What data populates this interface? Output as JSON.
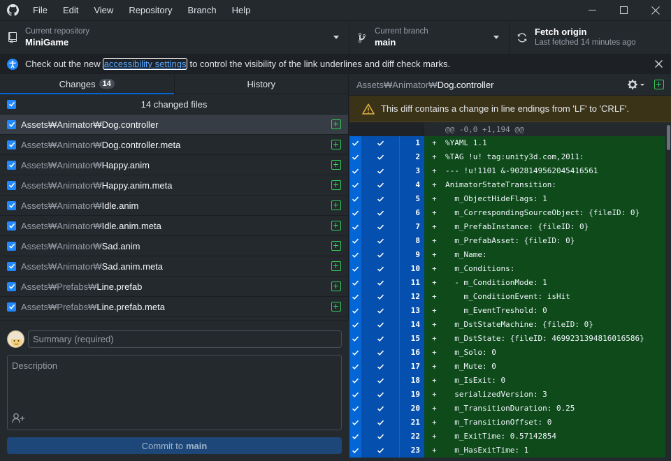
{
  "menu": [
    "File",
    "Edit",
    "View",
    "Repository",
    "Branch",
    "Help"
  ],
  "toolbar": {
    "repo_label": "Current repository",
    "repo_value": "MiniGame",
    "branch_label": "Current branch",
    "branch_value": "main",
    "fetch_label": "Fetch origin",
    "fetch_sub": "Last fetched 14 minutes ago"
  },
  "banner": {
    "before": "Check out the new",
    "link": "accessibility settings",
    "after": "to control the visibility of the link underlines and diff check marks."
  },
  "tabs": {
    "changes": "Changes",
    "changes_count": "14",
    "history": "History"
  },
  "changed_header": "14 changed files",
  "files": [
    {
      "dir": "Assets₩Animator₩",
      "name": "Dog.controller",
      "selected": true
    },
    {
      "dir": "Assets₩Animator₩",
      "name": "Dog.controller.meta"
    },
    {
      "dir": "Assets₩Animator₩",
      "name": "Happy.anim"
    },
    {
      "dir": "Assets₩Animator₩",
      "name": "Happy.anim.meta"
    },
    {
      "dir": "Assets₩Animator₩",
      "name": "Idle.anim"
    },
    {
      "dir": "Assets₩Animator₩",
      "name": "Idle.anim.meta"
    },
    {
      "dir": "Assets₩Animator₩",
      "name": "Sad.anim"
    },
    {
      "dir": "Assets₩Animator₩",
      "name": "Sad.anim.meta"
    },
    {
      "dir": "Assets₩Prefabs₩",
      "name": "Line.prefab"
    },
    {
      "dir": "Assets₩Prefabs₩",
      "name": "Line.prefab.meta"
    }
  ],
  "commit": {
    "summary_placeholder": "Summary (required)",
    "description_placeholder": "Description",
    "button_prefix": "Commit to",
    "button_branch": "main"
  },
  "diff": {
    "path_dir": "Assets₩Animator₩",
    "path_name": "Dog.controller",
    "warning": "This diff contains a change in line endings from 'LF' to 'CRLF'.",
    "hunk": "@@ -0,0 +1,194 @@",
    "lines": [
      {
        "n": "1",
        "t": "%YAML 1.1"
      },
      {
        "n": "2",
        "t": "%TAG !u! tag:unity3d.com,2011:"
      },
      {
        "n": "3",
        "t": "--- !u!1101 &-9028149562045416561"
      },
      {
        "n": "4",
        "t": "AnimatorStateTransition:"
      },
      {
        "n": "5",
        "t": "  m_ObjectHideFlags: 1"
      },
      {
        "n": "6",
        "t": "  m_CorrespondingSourceObject: {fileID: 0}"
      },
      {
        "n": "7",
        "t": "  m_PrefabInstance: {fileID: 0}"
      },
      {
        "n": "8",
        "t": "  m_PrefabAsset: {fileID: 0}"
      },
      {
        "n": "9",
        "t": "  m_Name:"
      },
      {
        "n": "10",
        "t": "  m_Conditions:"
      },
      {
        "n": "11",
        "t": "  - m_ConditionMode: 1"
      },
      {
        "n": "12",
        "t": "    m_ConditionEvent: isHit"
      },
      {
        "n": "13",
        "t": "    m_EventTreshold: 0"
      },
      {
        "n": "14",
        "t": "  m_DstStateMachine: {fileID: 0}"
      },
      {
        "n": "15",
        "t": "  m_DstState: {fileID: 4699231394816016586}"
      },
      {
        "n": "16",
        "t": "  m_Solo: 0"
      },
      {
        "n": "17",
        "t": "  m_Mute: 0"
      },
      {
        "n": "18",
        "t": "  m_IsExit: 0"
      },
      {
        "n": "19",
        "t": "  serializedVersion: 3"
      },
      {
        "n": "20",
        "t": "  m_TransitionDuration: 0.25"
      },
      {
        "n": "21",
        "t": "  m_TransitionOffset: 0"
      },
      {
        "n": "22",
        "t": "  m_ExitTime: 0.57142854"
      },
      {
        "n": "23",
        "t": "  m_HasExitTime: 1"
      }
    ]
  },
  "colors": {
    "accent": "#0366d6",
    "added_green": "#34d058",
    "diff_added_bg": "#0e4a1a",
    "warning_bg": "#3b3318"
  }
}
